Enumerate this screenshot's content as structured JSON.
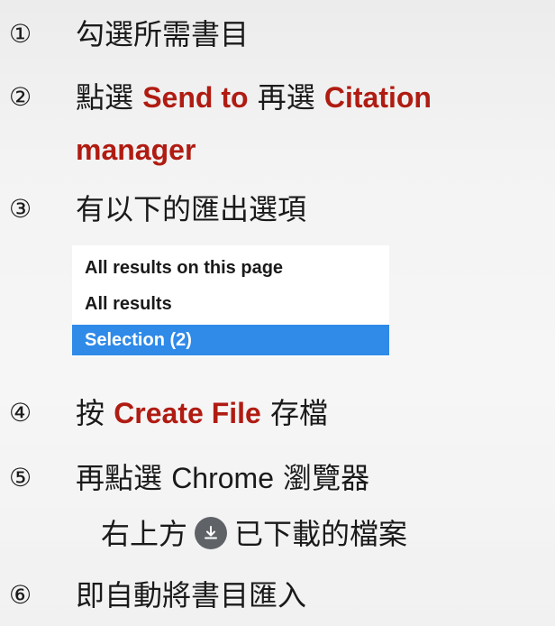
{
  "steps": {
    "s1": {
      "num": "①",
      "text": "勾選所需書目"
    },
    "s2": {
      "num": "②",
      "pre": "點選 ",
      "hl1": "Send to",
      "mid": " 再選 ",
      "hl2": "Citation",
      "hl3": "manager"
    },
    "s3": {
      "num": "③",
      "text": "有以下的匯出選項"
    },
    "s4": {
      "num": "④",
      "pre": "按 ",
      "hl": "Create File",
      "post": " 存檔"
    },
    "s5": {
      "num": "⑤",
      "pre": "再點選 ",
      "lat": "Chrome",
      "post": " 瀏覽器",
      "line2_pre": "右上方",
      "line2_post": "已下載的檔案"
    },
    "s6": {
      "num": "⑥",
      "text": "即自動將書目匯入"
    }
  },
  "dropdown": {
    "options": [
      "All results on this page",
      "All results",
      "Selection (2)"
    ],
    "selected_index": 2,
    "selected_color": "#2f8ae8"
  },
  "accent_color": "#b01c12",
  "icons": {
    "download": "download-icon"
  }
}
